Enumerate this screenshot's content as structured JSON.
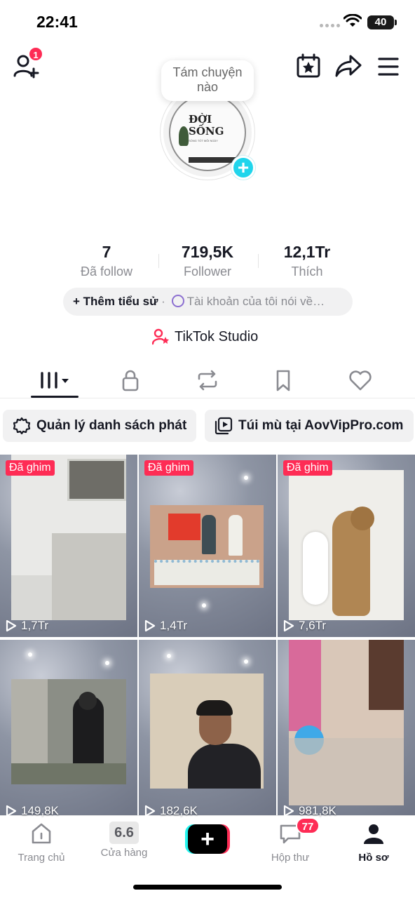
{
  "status_bar": {
    "time": "22:41",
    "battery": "40"
  },
  "header": {
    "notification_count": "1"
  },
  "profile": {
    "note_bubble": "Tám chuyện nào",
    "avatar_text": "ĐỜI SỐNG",
    "avatar_subtext": "SỐNG TỐT MỖI NGÀY"
  },
  "stats": [
    {
      "value": "7",
      "label": "Đã follow"
    },
    {
      "value": "719,5K",
      "label": "Follower"
    },
    {
      "value": "12,1Tr",
      "label": "Thích"
    }
  ],
  "bio": {
    "add_label": "+ Thêm tiểu sử",
    "separator": "·",
    "placeholder": "Tài khoản của tôi nói về…"
  },
  "studio_label": "TikTok Studio",
  "playlists": [
    {
      "label": "Quản lý danh sách phát"
    },
    {
      "label": "Túi mù tại AovVipPro.com"
    }
  ],
  "videos": [
    {
      "pinned": "Đã ghim",
      "views": "1,7Tr"
    },
    {
      "pinned": "Đã ghim",
      "views": "1,4Tr"
    },
    {
      "pinned": "Đã ghim",
      "views": "7,6Tr"
    },
    {
      "pinned": "",
      "views": "149,8K"
    },
    {
      "pinned": "",
      "views": "182,6K"
    },
    {
      "pinned": "",
      "views": "981,8K"
    }
  ],
  "nav": {
    "home": "Trang chủ",
    "shop": "Cửa hàng",
    "shop_badge": "6.6",
    "inbox": "Hộp thư",
    "inbox_badge": "77",
    "profile": "Hồ sơ"
  },
  "colors": {
    "accent": "#fe2c55",
    "cyan": "#25f4ee",
    "text": "#161823",
    "muted": "#8a8b91"
  }
}
